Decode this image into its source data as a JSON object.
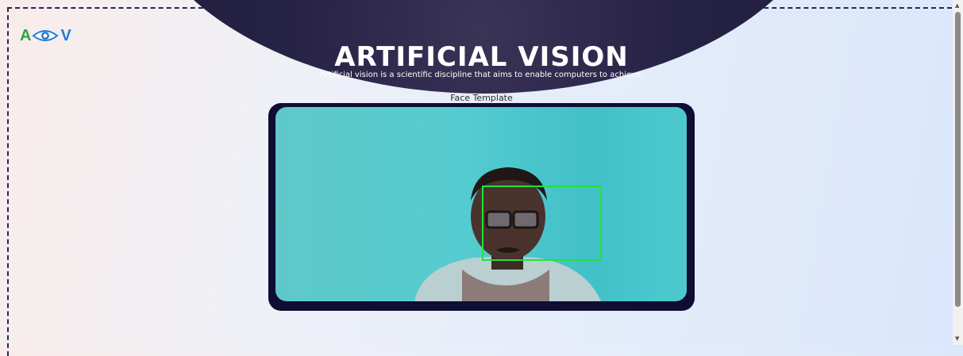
{
  "header": {
    "logo_left": "A",
    "logo_right": "V",
    "title": "ARTIFICIAL VISION",
    "subtitle": "Artificial vision is a scientific discipline that aims to enable computers to achieve."
  },
  "main": {
    "frame_label": "Face Template",
    "detection_color": "#22e23a"
  },
  "colors": {
    "hero": "#1c1a38",
    "frame": "#0f0d33",
    "logo_a": "#2fa24a",
    "logo_v": "#1f7fd6"
  }
}
